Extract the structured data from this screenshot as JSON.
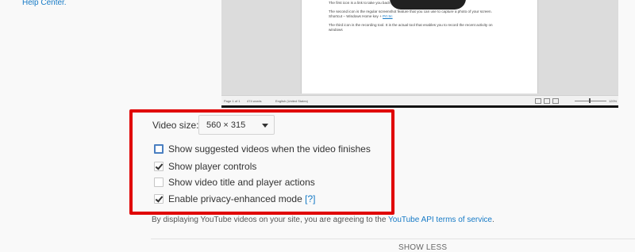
{
  "top": {
    "help_center": "Help Center."
  },
  "preview": {
    "doc_lines": [
      "The first icon is a link to take you back to the … for this and it is not very relevant.",
      "The second icon is the regular screenshot feature that you can use to capture a photo of your screen.",
      "Shortcut – Windows Home key +",
      "The third icon is the recording tool. It is the actual tool that enables you to record the recent activity on",
      "windows"
    ],
    "doc_link": "Prt Sc",
    "status_page": "Page 1 of 1",
    "status_words": "474 words",
    "status_language": "English (United States)",
    "status_zoom": "120%"
  },
  "options": {
    "video_size_label": "Video size:",
    "video_size_value": "560 × 315",
    "items": [
      {
        "label": "Show suggested videos when the video finishes",
        "checked": false
      },
      {
        "label": "Show player controls",
        "checked": true
      },
      {
        "label": "Show video title and player actions",
        "checked": false
      },
      {
        "label": "Enable privacy-enhanced mode",
        "checked": true
      }
    ],
    "help_marker": "[?]"
  },
  "footer": {
    "terms_prefix": "By displaying YouTube videos on your site, you are agreeing to the",
    "terms_link": "YouTube API terms of service",
    "terms_suffix": ".",
    "show_less": "SHOW LESS"
  },
  "colors": {
    "highlight_border": "#e00000",
    "link": "#167ac6"
  }
}
